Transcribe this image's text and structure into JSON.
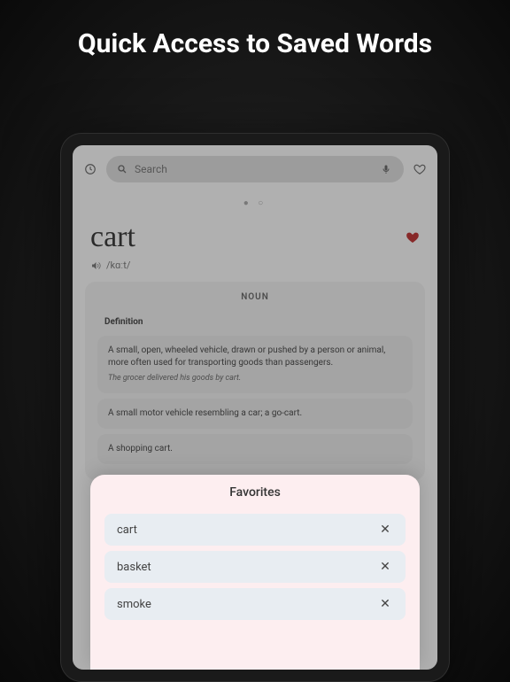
{
  "promo": {
    "title": "Quick Access to Saved Words"
  },
  "search": {
    "placeholder": "Search"
  },
  "page_dots": "● ○",
  "word": {
    "title": "cart",
    "pronunciation": "/kɑːt/"
  },
  "pos": "NOUN",
  "tab_label": "Definition",
  "definitions": [
    {
      "text": "A small, open, wheeled vehicle, drawn or pushed by a person or animal, more often used for transporting goods than passengers.",
      "example": "The grocer delivered his goods by cart."
    },
    {
      "text": "A small motor vehicle resembling a car; a go-cart.",
      "example": ""
    },
    {
      "text": "A shopping cart.",
      "example": ""
    }
  ],
  "favorites": {
    "title": "Favorites",
    "items": [
      "cart",
      "basket",
      "smoke"
    ]
  }
}
